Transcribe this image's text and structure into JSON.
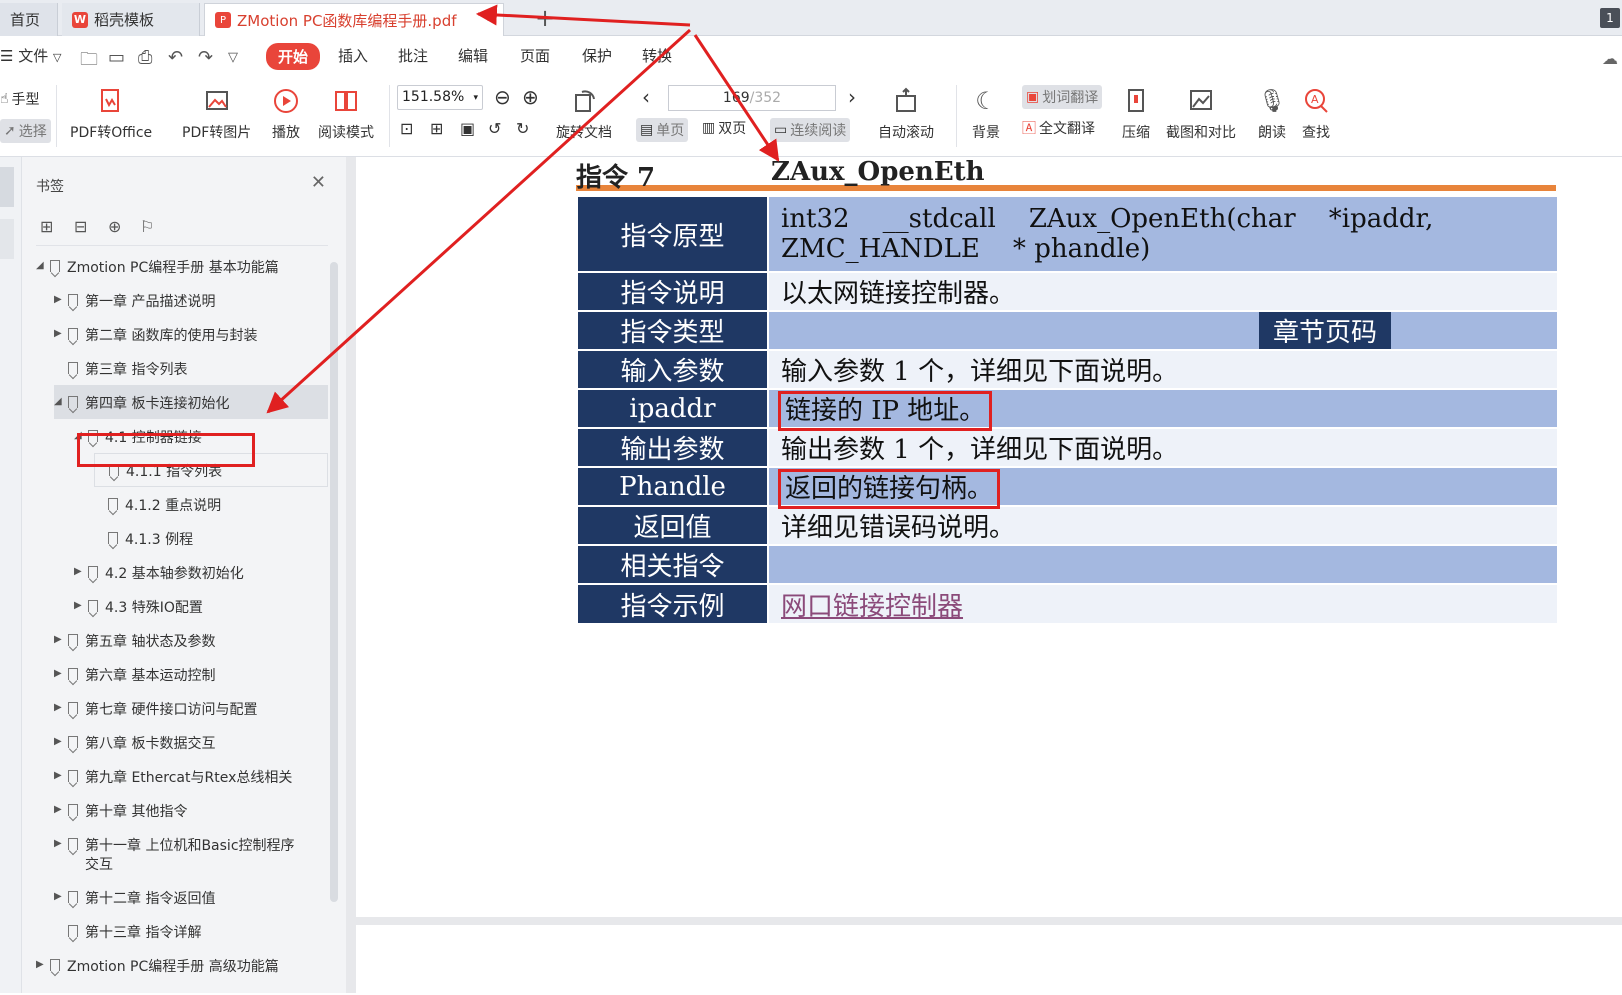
{
  "tabs": {
    "home": "首页",
    "template": "稻壳模板",
    "document": "ZMotion PC函数库编程手册.pdf",
    "win_badge": "1"
  },
  "menu": {
    "file": "文件",
    "items": [
      "开始",
      "插入",
      "批注",
      "编辑",
      "页面",
      "保护",
      "转换"
    ]
  },
  "ribbon": {
    "hand": "手型",
    "select": "选择",
    "pdf_to_office": "PDF转Office",
    "pdf_to_image": "PDF转图片",
    "play": "播放",
    "read_mode": "阅读模式",
    "zoom": "151.58%",
    "rotate": "旋转文档",
    "page_current": "169",
    "page_total": "/352",
    "single_page": "单页",
    "double_page": "双页",
    "continuous": "连续阅读",
    "auto_scroll": "自动滚动",
    "background": "背景",
    "word_translate": "划词翻译",
    "full_translate": "全文翻译",
    "compress": "压缩",
    "screenshot_compare": "截图和对比",
    "read_aloud": "朗读",
    "find": "查找"
  },
  "bookmarks": {
    "title": "书签",
    "items": [
      "Zmotion PC编程手册 基本功能篇",
      "第一章 产品描述说明",
      "第二章 函数库的使用与封装",
      "第三章 指令列表",
      "第四章 板卡连接初始化",
      "4.1 控制器链接",
      "4.1.1 指令列表",
      "4.1.2 重点说明",
      "4.1.3 例程",
      "4.2 基本轴参数初始化",
      "4.3 特殊IO配置",
      "第五章 轴状态及参数",
      "第六章 基本运动控制",
      "第七章 硬件接口访问与配置",
      "第八章 板卡数据交互",
      "第九章 Ethercat与Rtex总线相关",
      "第十章 其他指令",
      "第十一章 上位机和Basic控制程序",
      "交互",
      "第十二章 指令返回值",
      "第十三章 指令详解",
      "Zmotion PC编程手册 高级功能篇"
    ]
  },
  "document": {
    "cmd_no": "指令 7",
    "cmd_name": "ZAux_OpenEth",
    "rows": [
      {
        "label": "指令原型",
        "line1": "int32    __stdcall    ZAux_OpenEth(char    *ipaddr,",
        "line2": "ZMC_HANDLE    * phandle)"
      },
      {
        "label": "指令说明",
        "value": "以太网链接控制器。"
      },
      {
        "label": "指令类型",
        "value": "",
        "tag": "章节页码"
      },
      {
        "label": "输入参数",
        "value": "输入参数 1 个，详细见下面说明。"
      },
      {
        "label": "ipaddr",
        "value": "链接的 IP 地址。"
      },
      {
        "label": "输出参数",
        "value": "输出参数 1 个，详细见下面说明。"
      },
      {
        "label": "Phandle",
        "value": "返回的链接句柄。"
      },
      {
        "label": "返回值",
        "value": "详细见错误码说明。"
      },
      {
        "label": "相关指令",
        "value": ""
      },
      {
        "label": "指令示例",
        "value": "网口链接控制器"
      }
    ]
  },
  "colors": {
    "accent": "#e9453a",
    "table_header": "#1f3864",
    "table_alt": "#a4b8e0",
    "rule": "#e8843b",
    "annotation": "#e02020"
  }
}
